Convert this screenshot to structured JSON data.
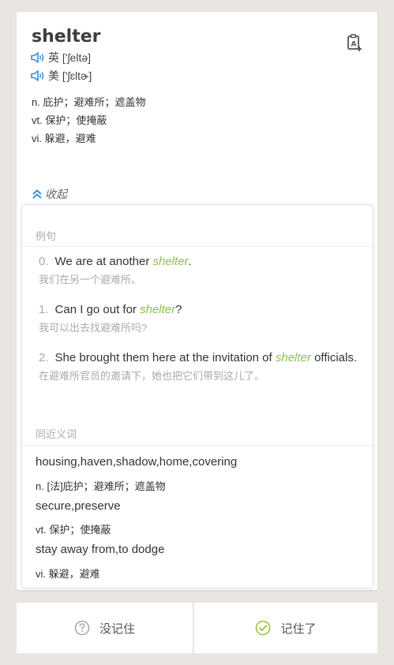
{
  "word": "shelter",
  "pronunciations": {
    "uk": {
      "label": "英",
      "ipa": "['ʃeltə]"
    },
    "us": {
      "label": "美",
      "ipa": "['ʃɛltɚ]"
    }
  },
  "definitions": [
    "n. 庇护；避难所；遮盖物",
    "vt. 保护；使掩蔽",
    "vi. 躲避，避难"
  ],
  "collapse_label": "收起",
  "examples_title": "例句",
  "examples": [
    {
      "num": "0.",
      "before": "We are at another ",
      "keyword": "shelter",
      "after": ".",
      "cn": "我们在另一个避难所。"
    },
    {
      "num": "1.",
      "before": "Can I go out for ",
      "keyword": "shelter",
      "after": "?",
      "cn": "我可以出去找避难所吗?"
    },
    {
      "num": "2.",
      "before": "She brought them here at the invitation of ",
      "keyword": "shelter",
      "after": " officials.",
      "cn": "在避难所官员的邀请下，她也把它们带到这儿了。"
    }
  ],
  "synonyms_title": "同近义词",
  "synonyms": [
    {
      "words": "housing,haven,shadow,home,covering",
      "meaning": "n. [法]庇护；避难所；遮盖物"
    },
    {
      "words": "secure,preserve",
      "meaning": "vt. 保护；使掩蔽"
    },
    {
      "words": "stay away from,to dodge",
      "meaning": "vi. 躲避，避难"
    }
  ],
  "buttons": {
    "forget": "没记住",
    "remember": "记住了"
  },
  "colors": {
    "accent": "#3a8fd6",
    "keyword": "#8bc34a",
    "check": "#9bc33a"
  }
}
